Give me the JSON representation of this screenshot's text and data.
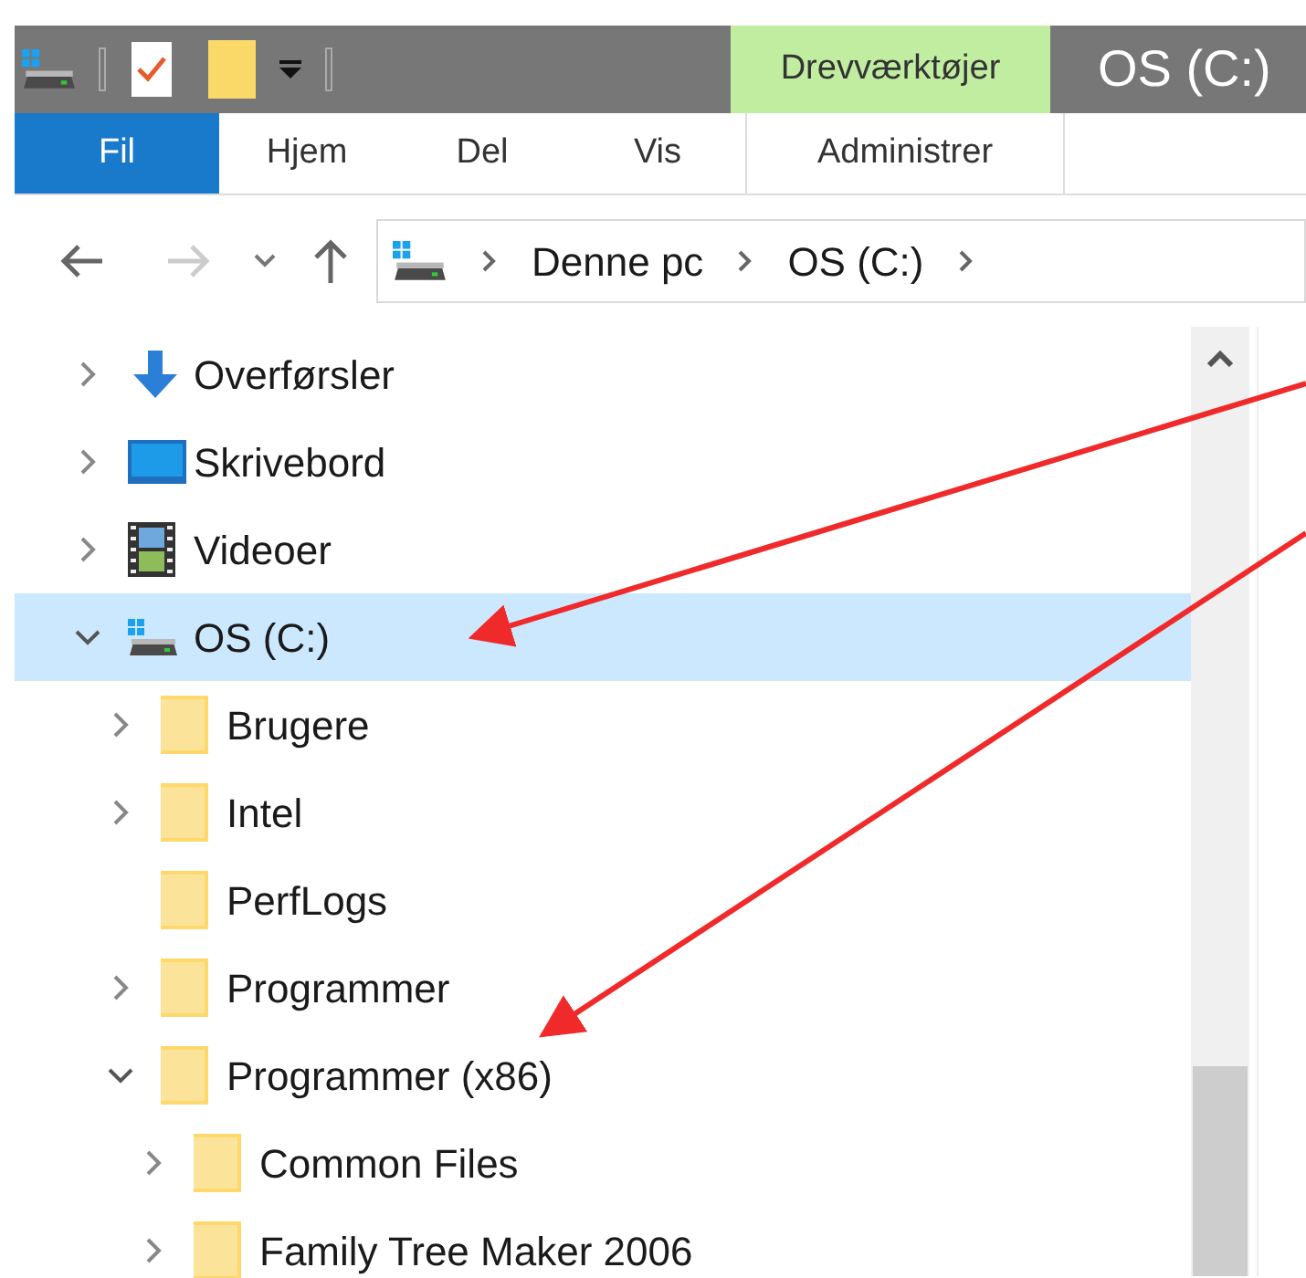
{
  "title_bar": {
    "context_group": "Drevværktøjer",
    "window_title": "OS (C:)"
  },
  "ribbon_tabs": [
    {
      "label": "Fil",
      "kind": "file",
      "selected": false
    },
    {
      "label": "Hjem",
      "kind": "normal",
      "selected": false
    },
    {
      "label": "Del",
      "kind": "normal",
      "selected": false
    },
    {
      "label": "Vis",
      "kind": "normal",
      "selected": false
    },
    {
      "label": "Administrer",
      "kind": "context",
      "selected": false
    }
  ],
  "navigation": {
    "back_disabled": false,
    "forward_disabled": true,
    "breadcrumb": [
      "Denne pc",
      "OS (C:)"
    ]
  },
  "tree": [
    {
      "label": "Overførsler",
      "kind": "downloads",
      "expandable": true,
      "expanded": false,
      "selected": false
    },
    {
      "label": "Skrivebord",
      "kind": "desktop",
      "expandable": true,
      "expanded": false,
      "selected": false
    },
    {
      "label": "Videoer",
      "kind": "videos",
      "expandable": true,
      "expanded": false,
      "selected": false
    },
    {
      "label": "OS (C:)",
      "kind": "drive",
      "expandable": true,
      "expanded": true,
      "selected": true,
      "children": [
        {
          "label": "Brugere",
          "kind": "folder",
          "expandable": true,
          "expanded": false,
          "selected": false
        },
        {
          "label": "Intel",
          "kind": "folder",
          "expandable": true,
          "expanded": false,
          "selected": false
        },
        {
          "label": "PerfLogs",
          "kind": "folder",
          "expandable": false,
          "expanded": false,
          "selected": false
        },
        {
          "label": "Programmer",
          "kind": "folder",
          "expandable": true,
          "expanded": false,
          "selected": false
        },
        {
          "label": "Programmer (x86)",
          "kind": "folder",
          "expandable": true,
          "expanded": true,
          "selected": false,
          "children": [
            {
              "label": "Common Files",
              "kind": "folder",
              "expandable": true,
              "expanded": false,
              "selected": false
            },
            {
              "label": "Family Tree Maker 2006",
              "kind": "folder",
              "expandable": true,
              "expanded": false,
              "selected": false
            }
          ]
        }
      ]
    }
  ]
}
